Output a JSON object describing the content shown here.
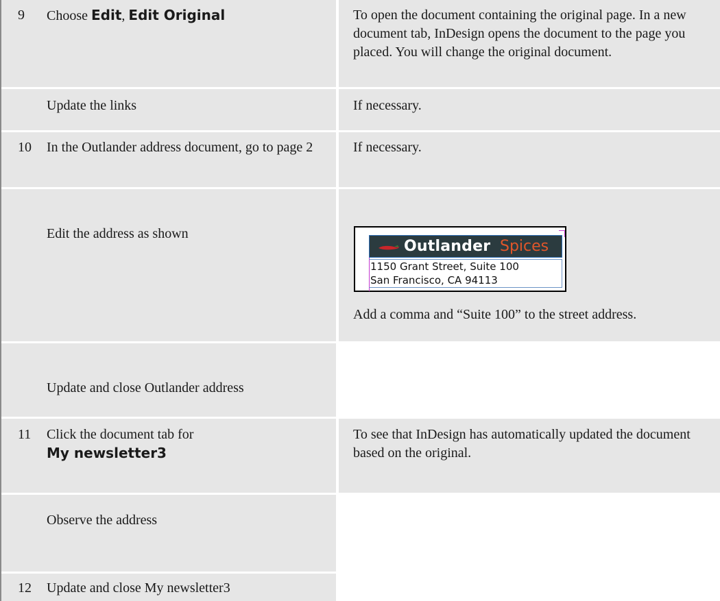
{
  "steps": {
    "s9": {
      "number": "9",
      "action_prefix": "Choose ",
      "action_kw1": "Edit",
      "action_sep": ", ",
      "action_kw2": "Edit Original",
      "result": "To open the document containing the original page. In a new document tab, InDesign opens the document to the page you placed. You will change the original document."
    },
    "update_links": {
      "action": "Update the links",
      "result": "If necessary."
    },
    "s10": {
      "number": "10",
      "action": "In the Outlander address document, go to page 2",
      "result": "If necessary."
    },
    "edit_address": {
      "action": "Edit the address as shown",
      "result": "Add a comma and “Suite 100” to the street address."
    },
    "update_close_address": {
      "action": "Update and close Outlander address"
    },
    "s11": {
      "number": "11",
      "action_prefix": "Click the document tab for",
      "action_kw": "My newsletter3",
      "result": "To see that InDesign has automatically updated the document based on the original."
    },
    "observe": {
      "action": "Observe the address"
    },
    "s12": {
      "number": "12",
      "action": "Update and close My newsletter3"
    }
  },
  "figure": {
    "logo_word1": "Outlander",
    "logo_word2": "Spices",
    "address_line1": "1150 Grant Street, Suite 100",
    "address_line2": "San Francisco, CA 94113"
  },
  "colors": {
    "row_background": "#e6e6e6",
    "logo_background": "#2b3b3f",
    "logo_accent": "#e0562a",
    "guide_magenta": "#c43ad0",
    "frame_blue": "#6b93c6"
  }
}
